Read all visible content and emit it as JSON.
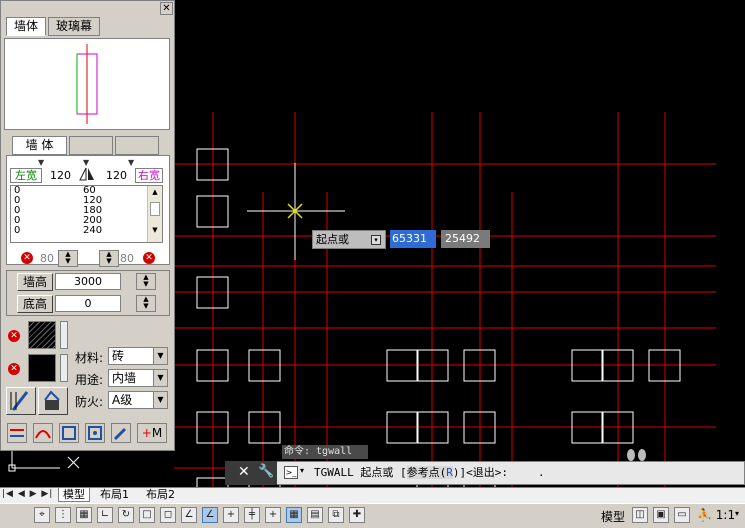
{
  "palette": {
    "close_glyph": "✕",
    "tabs": [
      "墙体",
      "玻璃幕"
    ],
    "subtab_active": "墙 体",
    "left_width_label": "左宽",
    "right_width_label": "右宽",
    "left_width_value": "120",
    "right_width_value": "120",
    "width_list": [
      {
        "left": "0",
        "right": "60"
      },
      {
        "left": "0",
        "right": "120"
      },
      {
        "left": "0",
        "right": "180"
      },
      {
        "left": "0",
        "right": "200"
      },
      {
        "left": "0",
        "right": "240"
      }
    ],
    "offset_left": "80",
    "offset_right": "80",
    "height_label": "墙高",
    "height_value": "3000",
    "base_label": "底高",
    "base_value": "0",
    "material_label": "材料:",
    "material_value": "砖",
    "usage_label": "用途:",
    "usage_value": "内墙",
    "fire_label": "防火:",
    "fire_value": "A级",
    "tool_m_label": "M"
  },
  "dynamic_input": {
    "prompt": "起点或",
    "x_value": "65331",
    "y_value": "25492"
  },
  "command": {
    "history": "命令: tgwall",
    "line_prefix": "TGWALL 起点或 [",
    "line_option": "参考点",
    "line_key": "R",
    "line_suffix": ")]<退出>:",
    "cursor_dot": "."
  },
  "layout_tabs": [
    "模型",
    "布局1",
    "布局2"
  ],
  "status_bar": {
    "model_label": "模型",
    "scale_label": "1:1"
  },
  "colors": {
    "grid_line": "#e00000",
    "wall_cursor": "#e8e000",
    "highlight_blue": "#2f6bd6"
  }
}
